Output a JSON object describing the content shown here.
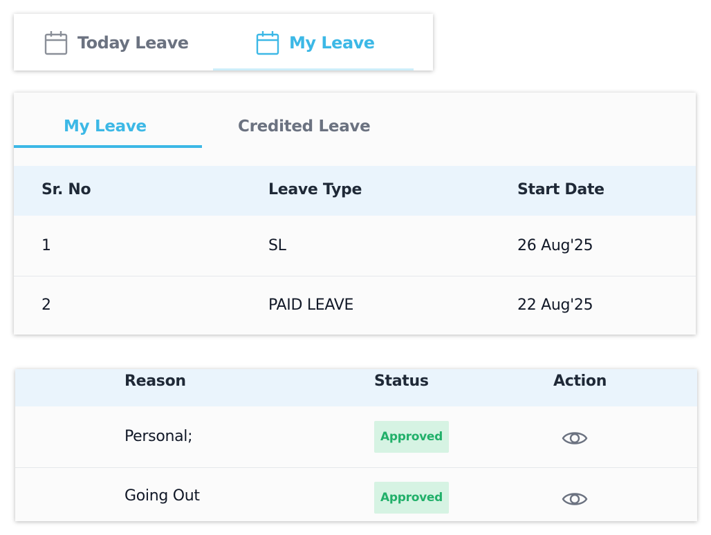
{
  "top_tabs": {
    "today_label": "Today Leave",
    "my_label": "My Leave",
    "active": "My Leave",
    "calendar_icon": "calendar-icon"
  },
  "sub_tabs": {
    "my_label": "My Leave",
    "credited_label": "Credited Leave",
    "active": "My Leave"
  },
  "leave_table": {
    "columns": [
      "Sr. No",
      "Leave Type",
      "Start Date"
    ],
    "rows": [
      {
        "sr_no": "1",
        "leave_type": "SL",
        "start_date": "26 Aug'25"
      },
      {
        "sr_no": "2",
        "leave_type": "PAID LEAVE",
        "start_date": "22 Aug'25"
      }
    ]
  },
  "detail_table": {
    "columns": [
      "Reason",
      "Status",
      "Action"
    ],
    "rows": [
      {
        "reason": "Personal;",
        "status": "Approved",
        "action_icon": "eye-icon"
      },
      {
        "reason": "Going Out",
        "status": "Approved",
        "action_icon": "eye-icon"
      }
    ]
  },
  "colors": {
    "accent": "#3cb8e6",
    "header_bg": "#eaf4fc",
    "status_approved_bg": "#d6f3e3",
    "status_approved_text": "#22b06a",
    "inactive_text": "#6b7280"
  }
}
